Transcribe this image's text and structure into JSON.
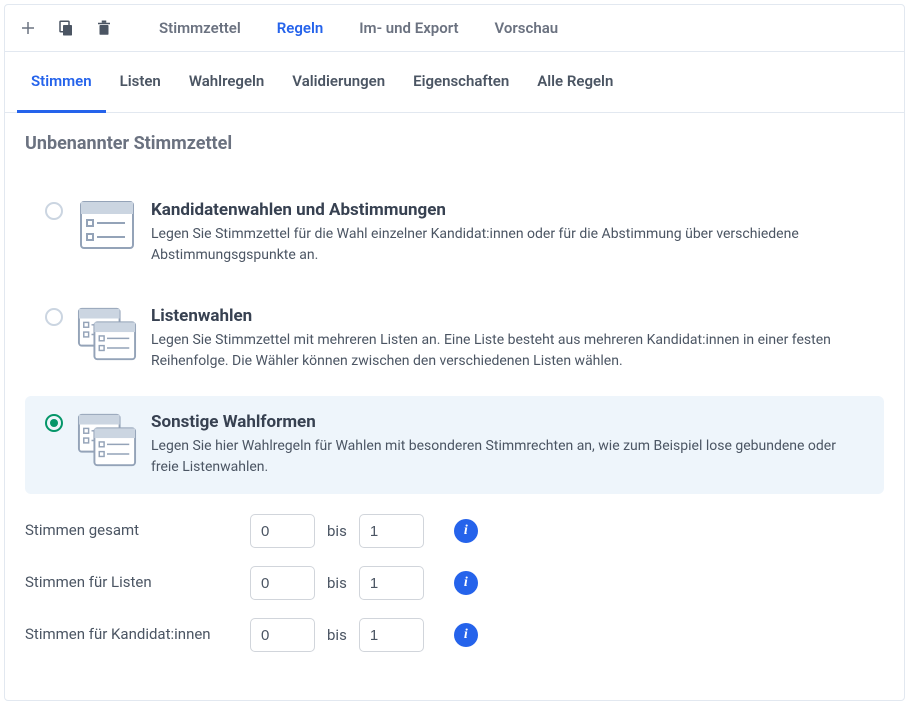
{
  "toolbar": {
    "nav": [
      "Stimmzettel",
      "Regeln",
      "Im- und Export",
      "Vorschau"
    ],
    "activeIndex": 1
  },
  "subTabs": {
    "items": [
      "Stimmen",
      "Listen",
      "Wahlregeln",
      "Validierungen",
      "Eigenschaften",
      "Alle Regeln"
    ],
    "activeIndex": 0
  },
  "sectionTitle": "Unbenannter Stimmzettel",
  "options": [
    {
      "title": "Kandidatenwahlen und Abstimmungen",
      "desc": "Legen Sie Stimmzettel für die Wahl einzelner Kandidat:innen oder für die Abstimmung über verschiedene Abstimmungsgspunkte an."
    },
    {
      "title": "Listenwahlen",
      "desc": "Legen Sie Stimmzettel mit mehreren Listen an. Eine Liste besteht aus mehreren Kandidat:innen in einer festen Reihenfolge. Die Wähler können zwischen den verschiedenen Listen wählen."
    },
    {
      "title": "Sonstige Wahlformen",
      "desc": "Legen Sie hier Wahlregeln für Wahlen mit besonderen Stimmrechten an, wie zum Beispiel lose gebundene oder freie Listenwahlen."
    }
  ],
  "optionsSelectedIndex": 2,
  "rows": [
    {
      "label": "Stimmen gesamt",
      "from": "0",
      "to": "1"
    },
    {
      "label": "Stimmen für Listen",
      "from": "0",
      "to": "1"
    },
    {
      "label": "Stimmen für Kandidat:innen",
      "from": "0",
      "to": "1"
    }
  ],
  "betweenWord": "bis",
  "infoGlyph": "i"
}
